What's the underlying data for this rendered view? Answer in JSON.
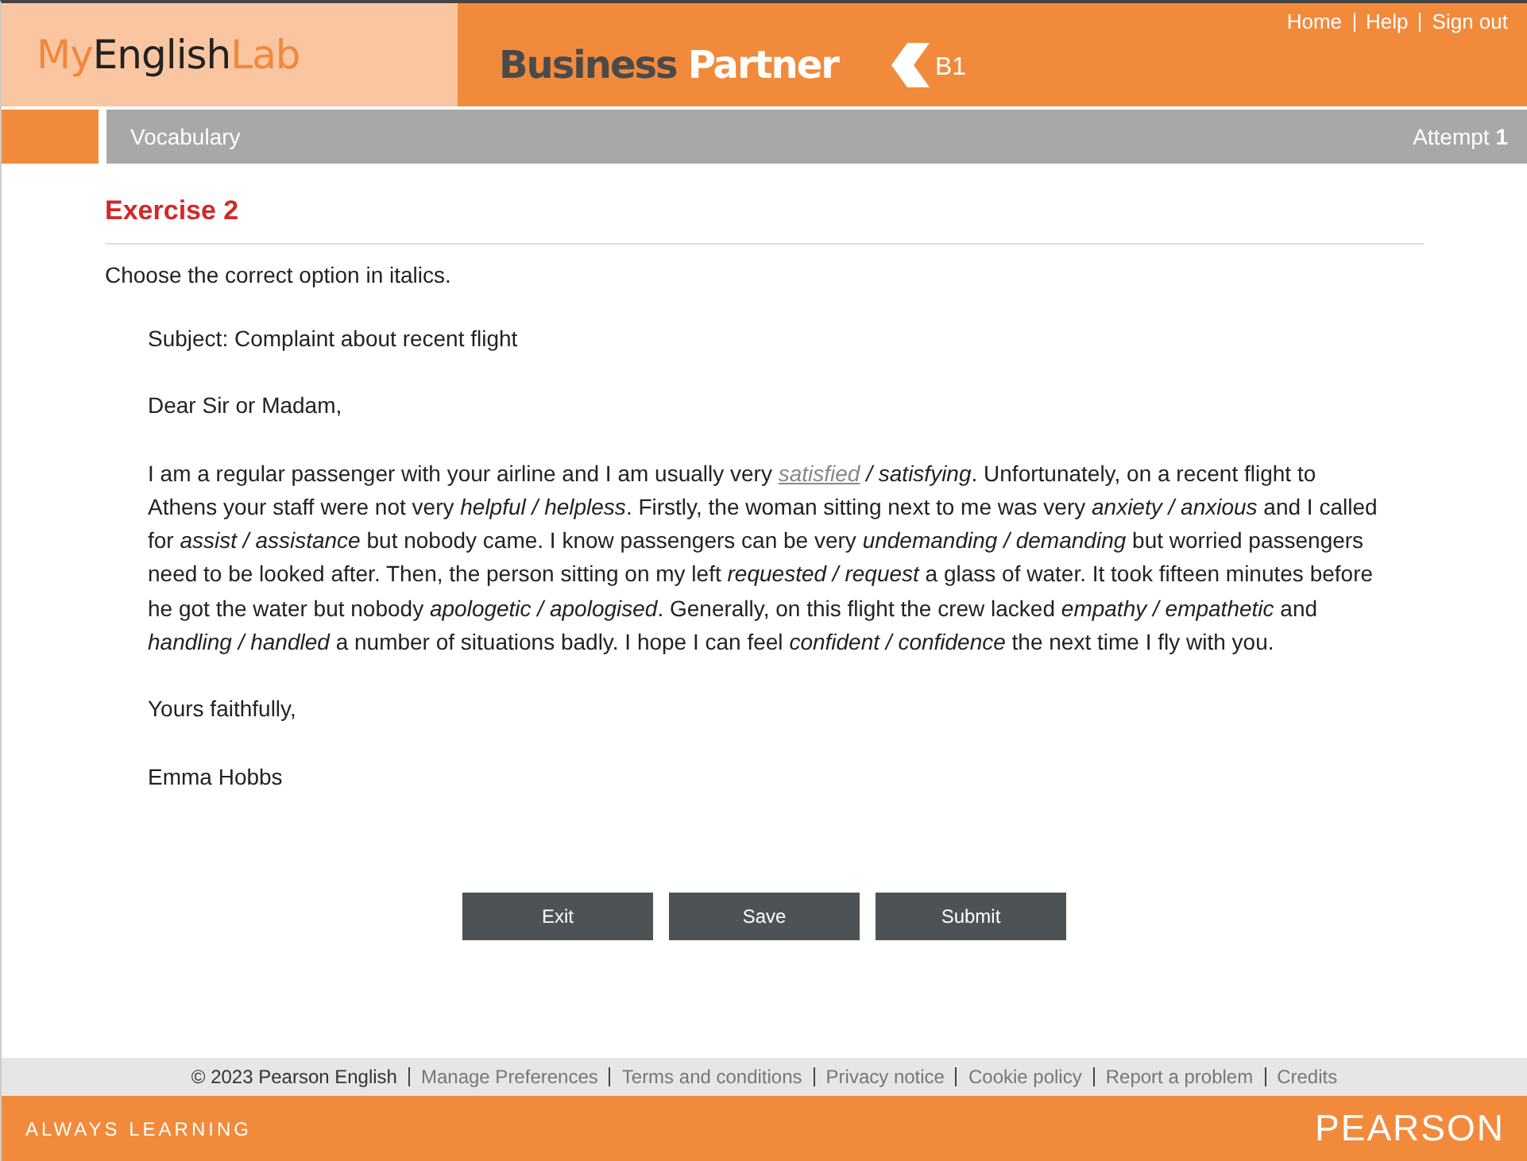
{
  "header": {
    "logo_parts": [
      "My",
      "English",
      "Lab"
    ],
    "product_parts": [
      "Business",
      "Partner"
    ],
    "level": "B1",
    "nav_links": [
      "Home",
      "Help",
      "Sign out"
    ]
  },
  "section_bar": {
    "title": "Vocabulary",
    "attempt_label": "Attempt",
    "attempt_number": "1"
  },
  "exercise": {
    "title": "Exercise 2",
    "instruction": "Choose the correct option in italics.",
    "subject": "Subject: Complaint about recent flight",
    "greeting": "Dear Sir or Madam,",
    "option_separator": " / ",
    "paragraph": [
      {
        "kind": "text",
        "text": "I am a regular passenger with your airline and I am usually very "
      },
      {
        "kind": "choice",
        "options": [
          {
            "text": "satisfied",
            "selected": true
          },
          {
            "text": "satisfying",
            "selected": false
          }
        ]
      },
      {
        "kind": "text",
        "text": ". Unfortunately, on a recent flight to Athens your staff were not very "
      },
      {
        "kind": "choice",
        "options": [
          {
            "text": "helpful",
            "selected": false
          },
          {
            "text": "helpless",
            "selected": false
          }
        ]
      },
      {
        "kind": "text",
        "text": ". Firstly, the woman sitting next to me was very "
      },
      {
        "kind": "choice",
        "options": [
          {
            "text": "anxiety",
            "selected": false
          },
          {
            "text": "anxious",
            "selected": false
          }
        ]
      },
      {
        "kind": "text",
        "text": " and I called for "
      },
      {
        "kind": "choice",
        "options": [
          {
            "text": "assist",
            "selected": false
          },
          {
            "text": "assistance",
            "selected": false
          }
        ]
      },
      {
        "kind": "text",
        "text": " but nobody came. I know passengers can be very "
      },
      {
        "kind": "choice",
        "options": [
          {
            "text": "undemanding",
            "selected": false
          },
          {
            "text": "demanding",
            "selected": false
          }
        ]
      },
      {
        "kind": "text",
        "text": " but worried passengers need to be looked after. Then, the person sitting on my left "
      },
      {
        "kind": "choice",
        "options": [
          {
            "text": "requested",
            "selected": false
          },
          {
            "text": "request",
            "selected": false
          }
        ]
      },
      {
        "kind": "text",
        "text": " a glass of water. It took fifteen minutes before he got the water but nobody "
      },
      {
        "kind": "choice",
        "options": [
          {
            "text": "apologetic",
            "selected": false
          },
          {
            "text": "apologised",
            "selected": false
          }
        ]
      },
      {
        "kind": "text",
        "text": ". Generally, on this flight the crew lacked "
      },
      {
        "kind": "choice",
        "options": [
          {
            "text": "empathy",
            "selected": false
          },
          {
            "text": "empathetic",
            "selected": false
          }
        ]
      },
      {
        "kind": "text",
        "text": " and "
      },
      {
        "kind": "choice",
        "options": [
          {
            "text": "handling",
            "selected": false
          },
          {
            "text": "handled",
            "selected": false
          }
        ]
      },
      {
        "kind": "text",
        "text": " a number of situations badly. I hope I can feel "
      },
      {
        "kind": "choice",
        "options": [
          {
            "text": "confident",
            "selected": false
          },
          {
            "text": "confidence",
            "selected": false
          }
        ]
      },
      {
        "kind": "text",
        "text": " the next time I fly with you."
      }
    ],
    "closing": "Yours faithfully,",
    "signature": "Emma Hobbs"
  },
  "buttons": [
    "Exit",
    "Save",
    "Submit"
  ],
  "footer": {
    "copyright": "© 2023 Pearson English",
    "links": [
      "Manage Preferences",
      "Terms and conditions",
      "Privacy notice",
      "Cookie policy",
      "Report a problem",
      "Credits"
    ],
    "tagline": "ALWAYS LEARNING",
    "brand": "PEARSON"
  }
}
